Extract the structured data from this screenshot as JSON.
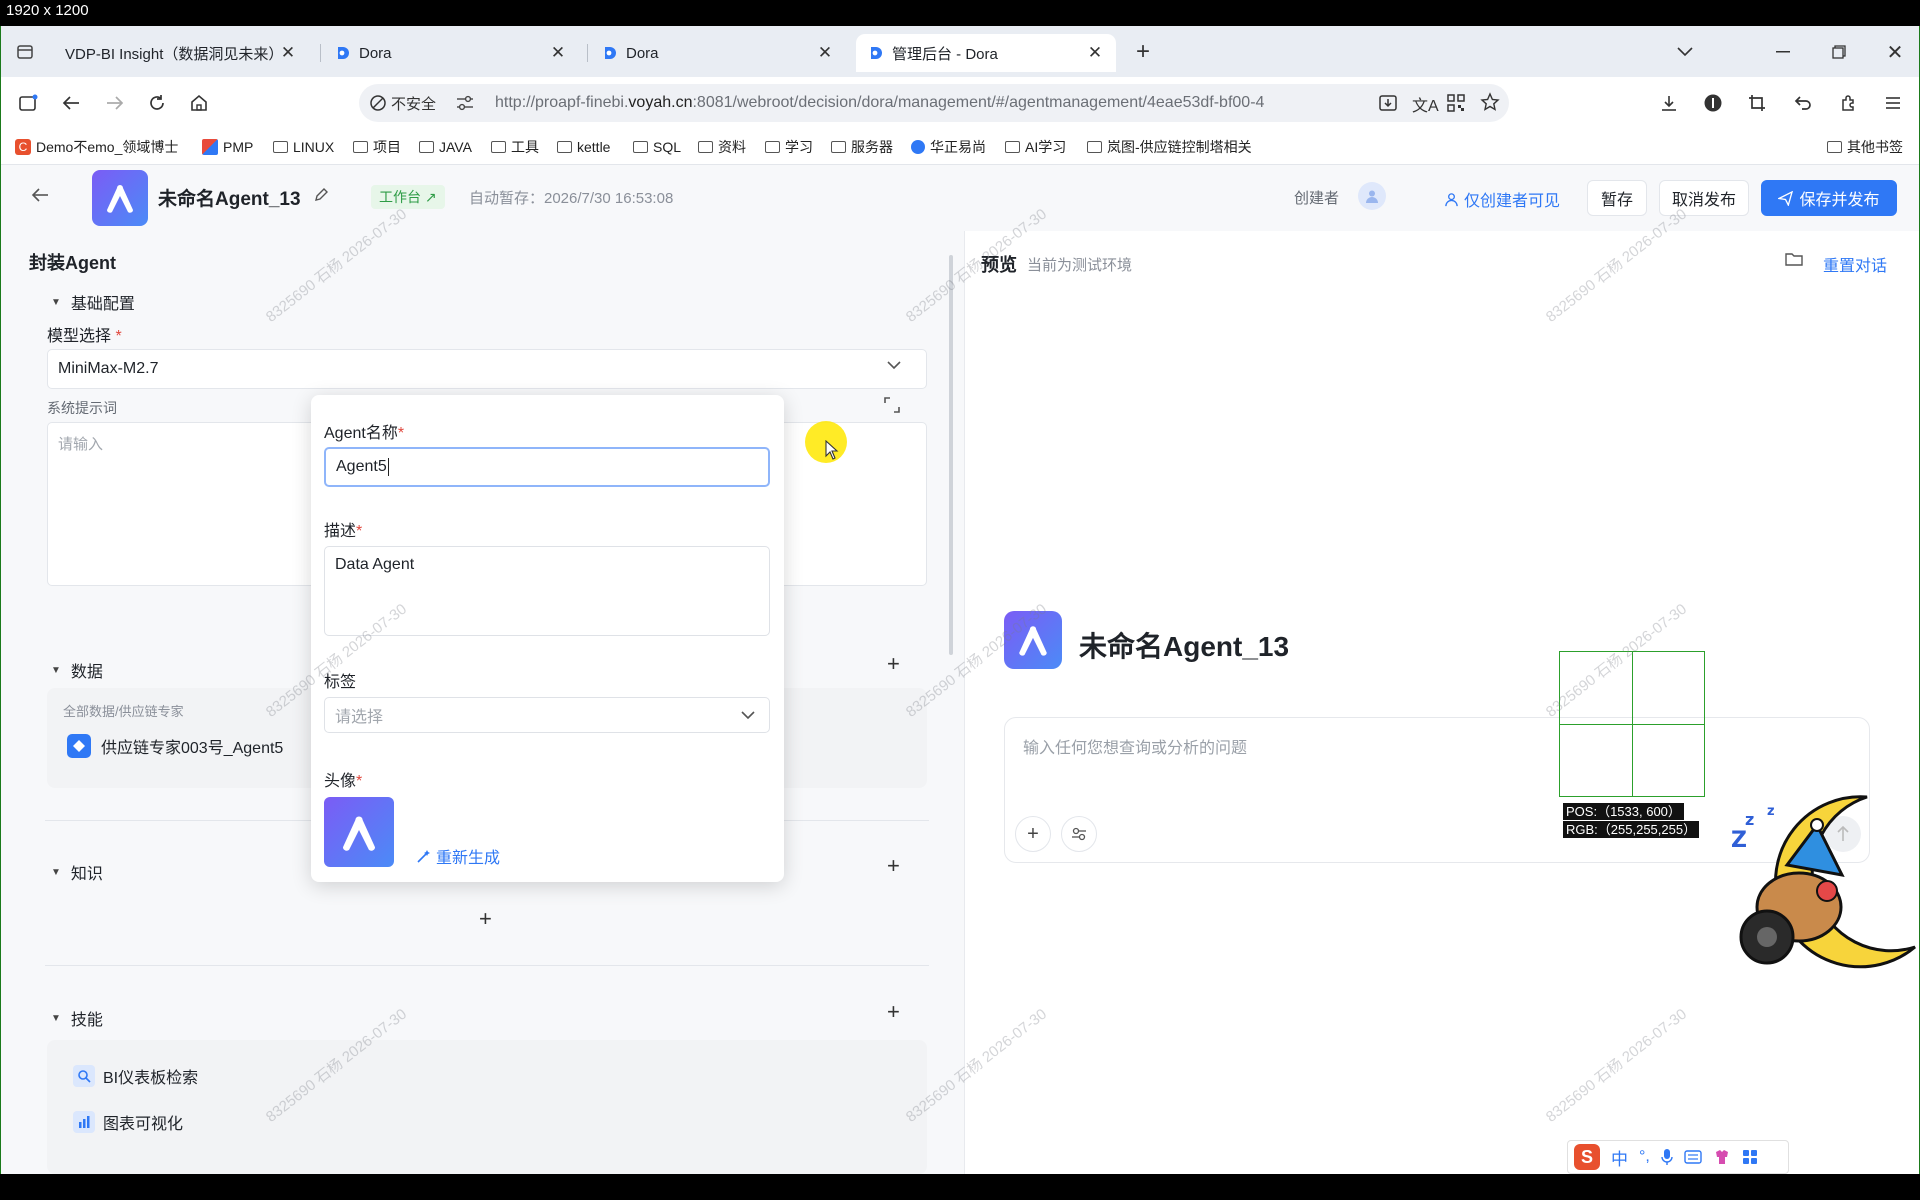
{
  "screen_label": "1920 x 1200",
  "tabs": [
    {
      "title": "VDP-BI Insight（数据洞见未来）",
      "active": false
    },
    {
      "title": "Dora",
      "active": false
    },
    {
      "title": "Dora",
      "active": false
    },
    {
      "title": "管理后台 - Dora",
      "active": true
    }
  ],
  "address": {
    "insecure_label": "不安全",
    "url_prefix": "http://proapf-finebi.",
    "url_domain": "voyah.cn",
    "url_suffix": ":8081/webroot/decision/dora/management/#/agentmanagement/4eae53df-bf00-4"
  },
  "bookmarks": [
    "Demo不emo_领域博士",
    "PMP",
    "LINUX",
    "项目",
    "JAVA",
    "工具",
    "kettle",
    "SQL",
    "资料",
    "学习",
    "服务器",
    "华正易尚",
    "AI学习",
    "岚图-供应链控制塔相关"
  ],
  "bookmarks_other": "其他书签",
  "header": {
    "agent_name": "未命名Agent_13",
    "workbench_tag": "工作台 ↗",
    "autosave": "自动暂存：2026/7/30 16:53:08",
    "creator_label": "创建者",
    "visibility": "仅创建者可见",
    "save_draft": "暂存",
    "unpublish": "取消发布",
    "save_publish": "保存并发布"
  },
  "left": {
    "title": "封装Agent",
    "basic_config": "基础配置",
    "model_label": "模型选择",
    "model_value": "MiniMax-M2.7",
    "prompt_label": "系统提示词",
    "prompt_placeholder": "请输入",
    "data_section": "数据",
    "data_path": "全部数据/供应链专家",
    "data_item": "供应链专家003号_Agent5",
    "knowledge_section": "知识",
    "skills_section": "技能",
    "skill_1": "BI仪表板检索",
    "skill_2": "图表可视化"
  },
  "popover": {
    "name_label": "Agent名称",
    "name_value": "Agent5",
    "desc_label": "描述",
    "desc_value": "Data Agent",
    "tag_label": "标签",
    "tag_placeholder": "请选择",
    "avatar_label": "头像",
    "regenerate": "重新生成"
  },
  "preview": {
    "title": "预览",
    "env": "当前为测试环境",
    "reset": "重置对话",
    "agent_name": "未命名Agent_13",
    "input_placeholder": "输入任何您想查询或分析的问题"
  },
  "overlay": {
    "pos": "POS:（1533, 600）",
    "rgb": "RGB:（255,255,255）"
  },
  "watermark": "8325690 石杨 2026-07-30",
  "ime": {
    "lang": "中"
  },
  "colors": {
    "accent": "#2f78f5",
    "avatar_gradient_start": "#7b5cf5",
    "avatar_gradient_end": "#4b8bf7"
  }
}
